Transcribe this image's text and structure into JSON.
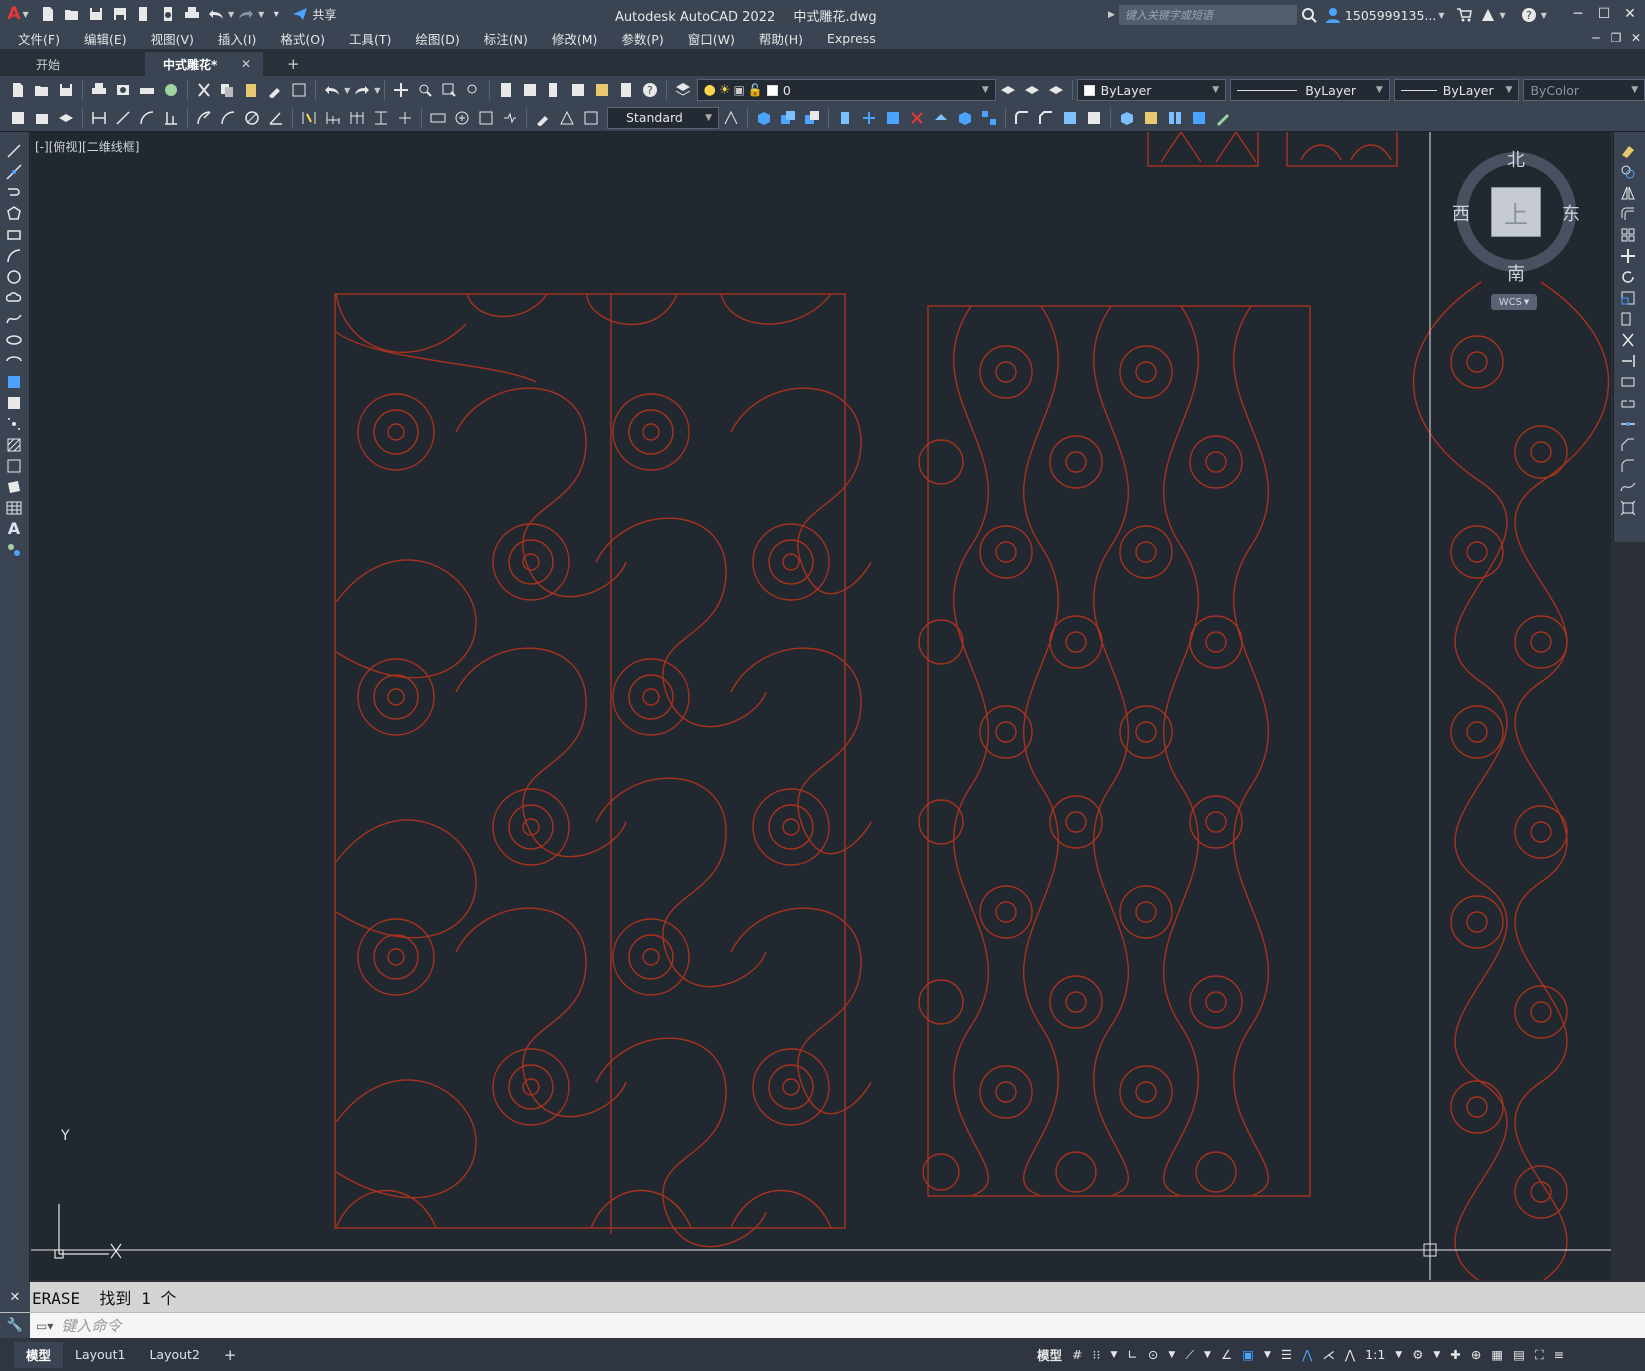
{
  "title_bar": {
    "app_title": "Autodesk AutoCAD 2022",
    "file_name": "中式雕花.dwg",
    "share_label": "共享",
    "search_placeholder": "键入关键字或短语",
    "user_name": "1505999135...",
    "app_logo_letter": "A"
  },
  "menu": {
    "items": [
      "文件(F)",
      "编辑(E)",
      "视图(V)",
      "插入(I)",
      "格式(O)",
      "工具(T)",
      "绘图(D)",
      "标注(N)",
      "修改(M)",
      "参数(P)",
      "窗口(W)",
      "帮助(H)",
      "Express"
    ]
  },
  "tabs": {
    "start": "开始",
    "active": "中式雕花*",
    "add": "+"
  },
  "toolbar": {
    "layer_value": "0",
    "color_value": "ByLayer",
    "linetype_value": "ByLayer",
    "lineweight_value": "ByLayer",
    "plotstyle_value": "ByColor",
    "textstyle_value": "Standard"
  },
  "viewport": {
    "label": "[-][俯视][二维线框]",
    "axis_y": "Y",
    "axis_x": "X"
  },
  "viewcube": {
    "north": "北",
    "south": "南",
    "east": "东",
    "west": "西",
    "top": "上",
    "wcs": "WCS"
  },
  "command": {
    "history": "ERASE  找到 1 个",
    "prompt": "键入命令"
  },
  "layout_tabs": {
    "model": "模型",
    "layout1": "Layout1",
    "layout2": "Layout2",
    "add": "+"
  },
  "status": {
    "model_label": "模型",
    "scale": "1:1"
  },
  "colors": {
    "drawing_line": "#a8321e",
    "canvas_bg": "#212830",
    "chrome": "#3b4453",
    "accent": "#4aa3ff"
  }
}
